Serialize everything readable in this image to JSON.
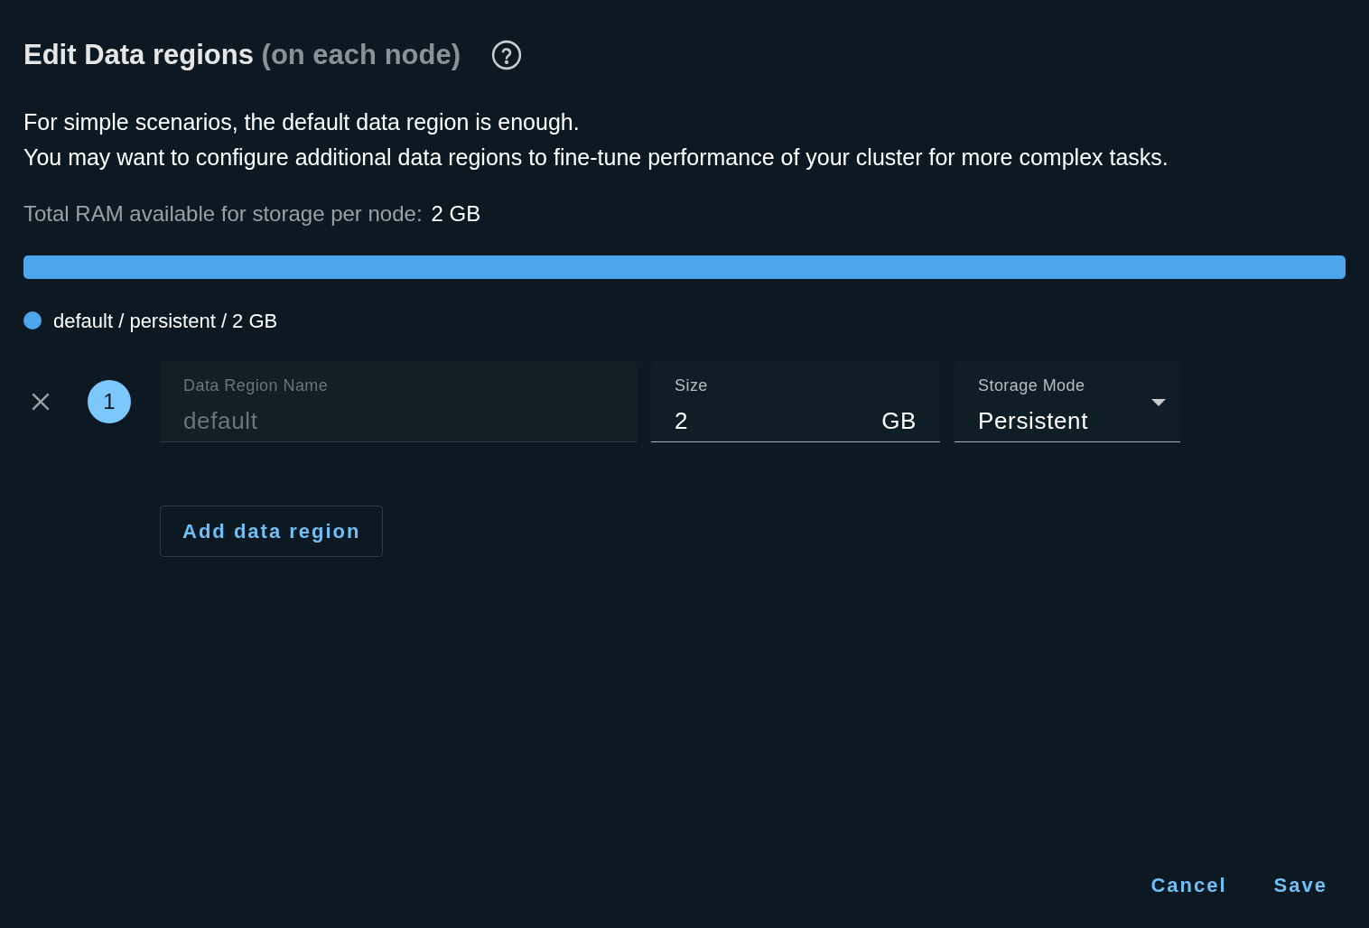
{
  "title": {
    "main": "Edit Data regions",
    "sub": "(on each node)"
  },
  "description": [
    "For simple scenarios, the default data region is enough.",
    "You may want to configure additional data regions to fine-tune performance of your cluster for more complex tasks."
  ],
  "total_ram": {
    "label": "Total RAM available for storage per node:",
    "value": "2 GB"
  },
  "usage_bar": {
    "segments": [
      {
        "level": 1,
        "color": "#4ba6ee"
      }
    ]
  },
  "legend": [
    {
      "label": "default / persistent / 2 GB",
      "color": "#4ba6ee"
    }
  ],
  "regions": [
    {
      "number": "1",
      "name_field": {
        "label": "Data Region Name",
        "value": "default",
        "disabled": true
      },
      "size_field": {
        "label": "Size",
        "value": "2",
        "unit": "GB"
      },
      "mode_field": {
        "label": "Storage Mode",
        "value": "Persistent"
      }
    }
  ],
  "add_button": "Add data region",
  "actions": [
    "Cancel",
    "Save"
  ]
}
